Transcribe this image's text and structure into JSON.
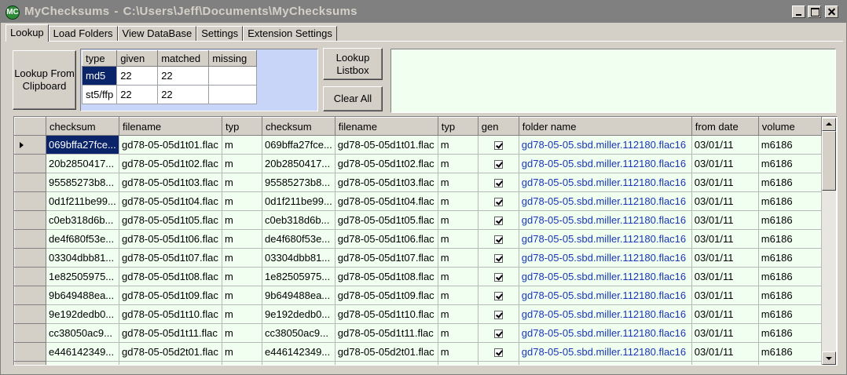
{
  "window": {
    "title": "MyChecksums",
    "path": "C:\\Users\\Jeff\\Documents\\MyChecksums",
    "app_icon": "MC"
  },
  "tabs": [
    {
      "label": "Lookup",
      "active": true
    },
    {
      "label": "Load Folders",
      "active": false
    },
    {
      "label": "View DataBase",
      "active": false
    },
    {
      "label": "Settings",
      "active": false
    },
    {
      "label": "Extension Settings",
      "active": false
    }
  ],
  "buttons": {
    "lookup_clipboard": "Lookup From Clipboard",
    "lookup_listbox": "Lookup Listbox",
    "clear_all": "Clear All"
  },
  "summary": {
    "headers": [
      "type",
      "given",
      "matched",
      "missing"
    ],
    "rows": [
      [
        "md5",
        "22",
        "22",
        ""
      ],
      [
        "st5/ffp",
        "22",
        "22",
        ""
      ]
    ]
  },
  "grid": {
    "headers": [
      "checksum",
      "filename",
      "typ",
      "checksum",
      "filename",
      "typ",
      "gen",
      "folder name",
      "from date",
      "volume"
    ],
    "rows": [
      {
        "c1": "069bffa27fce...",
        "f1": "gd78-05-05d1t01.flac",
        "t1": "m",
        "c2": "069bffa27fce...",
        "f2": "gd78-05-05d1t01.flac",
        "t2": "m",
        "gen": true,
        "folder": "gd78-05-05.sbd.miller.112180.flac16",
        "date": "03/01/11",
        "volume": "m6186"
      },
      {
        "c1": "20b2850417...",
        "f1": "gd78-05-05d1t02.flac",
        "t1": "m",
        "c2": "20b2850417...",
        "f2": "gd78-05-05d1t02.flac",
        "t2": "m",
        "gen": true,
        "folder": "gd78-05-05.sbd.miller.112180.flac16",
        "date": "03/01/11",
        "volume": "m6186"
      },
      {
        "c1": "95585273b8...",
        "f1": "gd78-05-05d1t03.flac",
        "t1": "m",
        "c2": "95585273b8...",
        "f2": "gd78-05-05d1t03.flac",
        "t2": "m",
        "gen": true,
        "folder": "gd78-05-05.sbd.miller.112180.flac16",
        "date": "03/01/11",
        "volume": "m6186"
      },
      {
        "c1": "0d1f211be99...",
        "f1": "gd78-05-05d1t04.flac",
        "t1": "m",
        "c2": "0d1f211be99...",
        "f2": "gd78-05-05d1t04.flac",
        "t2": "m",
        "gen": true,
        "folder": "gd78-05-05.sbd.miller.112180.flac16",
        "date": "03/01/11",
        "volume": "m6186"
      },
      {
        "c1": "c0eb318d6b...",
        "f1": "gd78-05-05d1t05.flac",
        "t1": "m",
        "c2": "c0eb318d6b...",
        "f2": "gd78-05-05d1t05.flac",
        "t2": "m",
        "gen": true,
        "folder": "gd78-05-05.sbd.miller.112180.flac16",
        "date": "03/01/11",
        "volume": "m6186"
      },
      {
        "c1": "de4f680f53e...",
        "f1": "gd78-05-05d1t06.flac",
        "t1": "m",
        "c2": "de4f680f53e...",
        "f2": "gd78-05-05d1t06.flac",
        "t2": "m",
        "gen": true,
        "folder": "gd78-05-05.sbd.miller.112180.flac16",
        "date": "03/01/11",
        "volume": "m6186"
      },
      {
        "c1": "03304dbb81...",
        "f1": "gd78-05-05d1t07.flac",
        "t1": "m",
        "c2": "03304dbb81...",
        "f2": "gd78-05-05d1t07.flac",
        "t2": "m",
        "gen": true,
        "folder": "gd78-05-05.sbd.miller.112180.flac16",
        "date": "03/01/11",
        "volume": "m6186"
      },
      {
        "c1": "1e82505975...",
        "f1": "gd78-05-05d1t08.flac",
        "t1": "m",
        "c2": "1e82505975...",
        "f2": "gd78-05-05d1t08.flac",
        "t2": "m",
        "gen": true,
        "folder": "gd78-05-05.sbd.miller.112180.flac16",
        "date": "03/01/11",
        "volume": "m6186"
      },
      {
        "c1": "9b649488ea...",
        "f1": "gd78-05-05d1t09.flac",
        "t1": "m",
        "c2": "9b649488ea...",
        "f2": "gd78-05-05d1t09.flac",
        "t2": "m",
        "gen": true,
        "folder": "gd78-05-05.sbd.miller.112180.flac16",
        "date": "03/01/11",
        "volume": "m6186"
      },
      {
        "c1": "9e192dedb0...",
        "f1": "gd78-05-05d1t10.flac",
        "t1": "m",
        "c2": "9e192dedb0...",
        "f2": "gd78-05-05d1t10.flac",
        "t2": "m",
        "gen": true,
        "folder": "gd78-05-05.sbd.miller.112180.flac16",
        "date": "03/01/11",
        "volume": "m6186"
      },
      {
        "c1": "cc38050ac9...",
        "f1": "gd78-05-05d1t11.flac",
        "t1": "m",
        "c2": "cc38050ac9...",
        "f2": "gd78-05-05d1t11.flac",
        "t2": "m",
        "gen": true,
        "folder": "gd78-05-05.sbd.miller.112180.flac16",
        "date": "03/01/11",
        "volume": "m6186"
      },
      {
        "c1": "e446142349...",
        "f1": "gd78-05-05d2t01.flac",
        "t1": "m",
        "c2": "e446142349...",
        "f2": "gd78-05-05d2t01.flac",
        "t2": "m",
        "gen": true,
        "folder": "gd78-05-05.sbd.miller.112180.flac16",
        "date": "03/01/11",
        "volume": "m6186"
      },
      {
        "c1": "",
        "f1": "",
        "t1": "",
        "c2": "",
        "f2": "",
        "t2": "",
        "gen": true,
        "folder": "",
        "date": "",
        "volume": ""
      }
    ]
  },
  "colors": {
    "grid_bg": "#f0fff0",
    "summary_bg": "#c8d4f8",
    "selection": "#0a246a",
    "folder_text": "#1a35b8"
  }
}
